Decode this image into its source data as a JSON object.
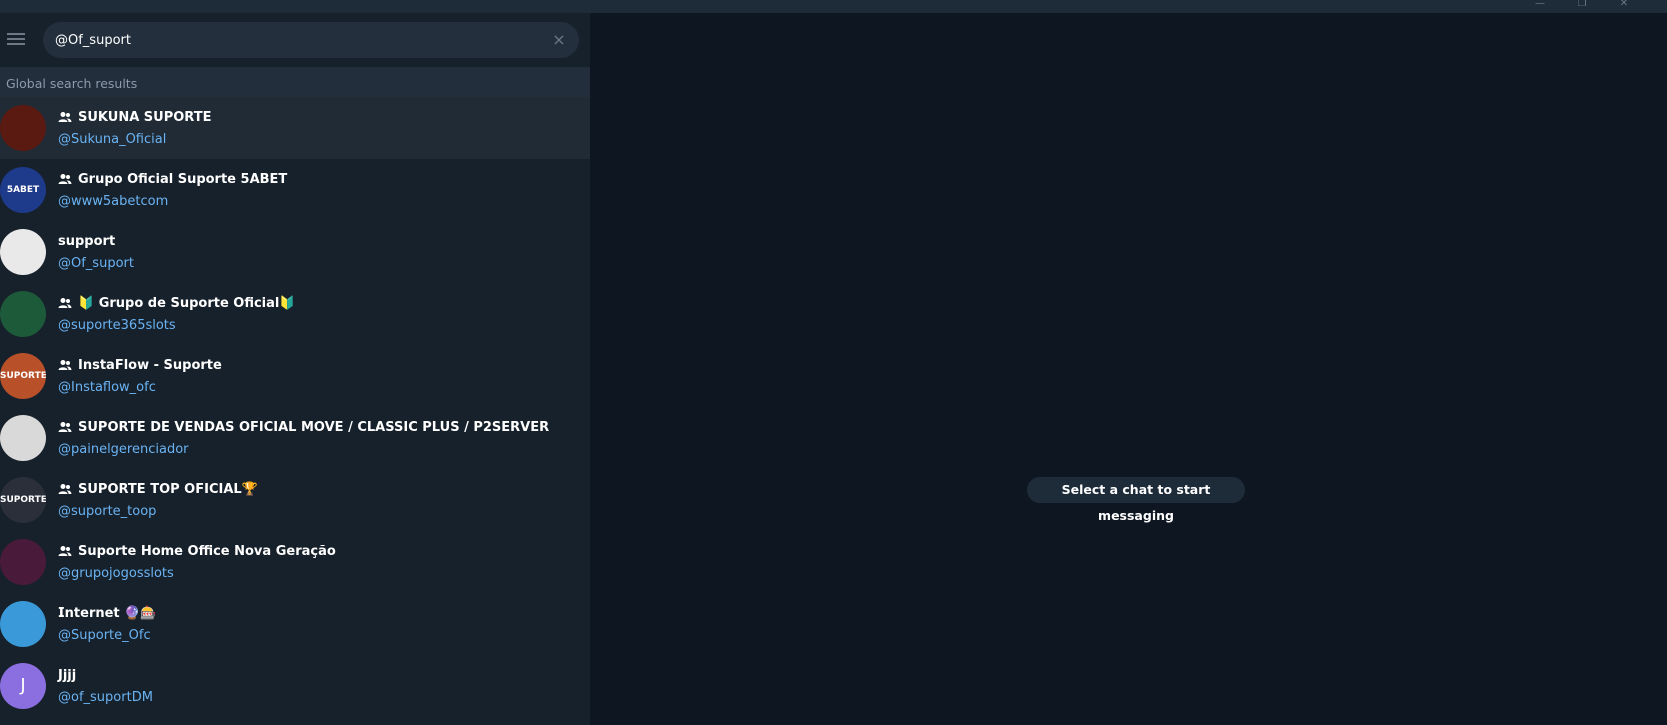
{
  "window": {
    "minimize_glyph": "—",
    "maximize_glyph": "❐",
    "close_glyph": "✕"
  },
  "search": {
    "value": "@Of_suport",
    "clear_icon": "×"
  },
  "section_header": "Global search results",
  "results": [
    {
      "title": "SUKUNA SUPORTE",
      "username": "@Sukuna_Oficial",
      "is_group": true,
      "avatar_color": "#5a1a12",
      "avatar_text": ""
    },
    {
      "title": "Grupo Oficial Suporte 5ABET",
      "username": "@www5abetcom",
      "is_group": true,
      "avatar_color": "#1e3a8a",
      "avatar_text": "5ABET"
    },
    {
      "title": "support",
      "username": "@Of_suport",
      "is_group": false,
      "avatar_color": "#e9e9e9",
      "avatar_text": ""
    },
    {
      "title": "🔰 Grupo de Suporte Oficial🔰",
      "username": "@suporte365slots",
      "is_group": true,
      "avatar_color": "#1d5a3a",
      "avatar_text": ""
    },
    {
      "title": "InstaFlow - Suporte",
      "username": "@Instaflow_ofc",
      "is_group": true,
      "avatar_color": "#b8502a",
      "avatar_text": "SUPORTE"
    },
    {
      "title": "SUPORTE DE VENDAS OFICIAL MOVE / CLASSIC PLUS / P2SERVER",
      "username": "@painelgerenciador",
      "is_group": true,
      "avatar_color": "#d9d9d9",
      "avatar_text": ""
    },
    {
      "title": "SUPORTE TOP OFICIAL🏆",
      "username": "@suporte_toop",
      "is_group": true,
      "avatar_color": "#2a2f3a",
      "avatar_text": "SUPORTE"
    },
    {
      "title": "Suporte Home Office Nova Geração",
      "username": "@grupojogosslots",
      "is_group": true,
      "avatar_color": "#4a1a3a",
      "avatar_text": ""
    },
    {
      "title": "𝗜𝗻𝘁𝗲𝗿𝗻𝗲𝘁 🔮🎰",
      "username": "@Suporte_Ofc",
      "is_group": false,
      "avatar_color": "#3a9ad9",
      "avatar_text": ""
    },
    {
      "title": "Jjjj",
      "username": "@of_suportDM",
      "is_group": false,
      "avatar_color": "#8b6fe0",
      "avatar_text": "J"
    }
  ],
  "main": {
    "placeholder": "Select a chat to start messaging"
  },
  "colors": {
    "accent_link": "#6ab3f3",
    "sidebar_bg": "#17212b",
    "chat_bg": "#0e1621"
  }
}
